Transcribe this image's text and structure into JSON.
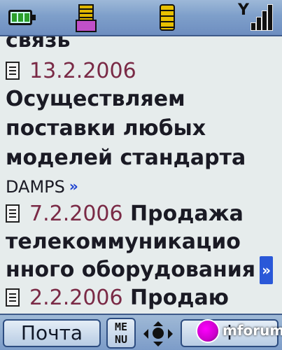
{
  "status_bar": {
    "icons": [
      "battery-icon",
      "new-message-icon",
      "sim-card-icon",
      "signal-strength-icon"
    ]
  },
  "content": {
    "header": "связь",
    "news": [
      {
        "date": "13.2.2006",
        "lines": [
          "Осуществляем",
          "поставки любых",
          "моделей стандарта",
          "DAMPS"
        ],
        "more": "»"
      },
      {
        "date": "7.2.2006",
        "title_first": "Продажа",
        "lines": [
          "телекоммуникацио",
          "нного оборудования"
        ],
        "more": "»"
      },
      {
        "date": "2.2.2006",
        "title_first": "Продаю"
      }
    ]
  },
  "softkeys": {
    "left": "Почта",
    "menu": "MENU",
    "right": "i"
  },
  "watermark": "mforum.ru",
  "colors": {
    "date": "#7a2a46",
    "text": "#1a1a24",
    "link": "#1a3fd0",
    "bar": "#7e9fca"
  }
}
